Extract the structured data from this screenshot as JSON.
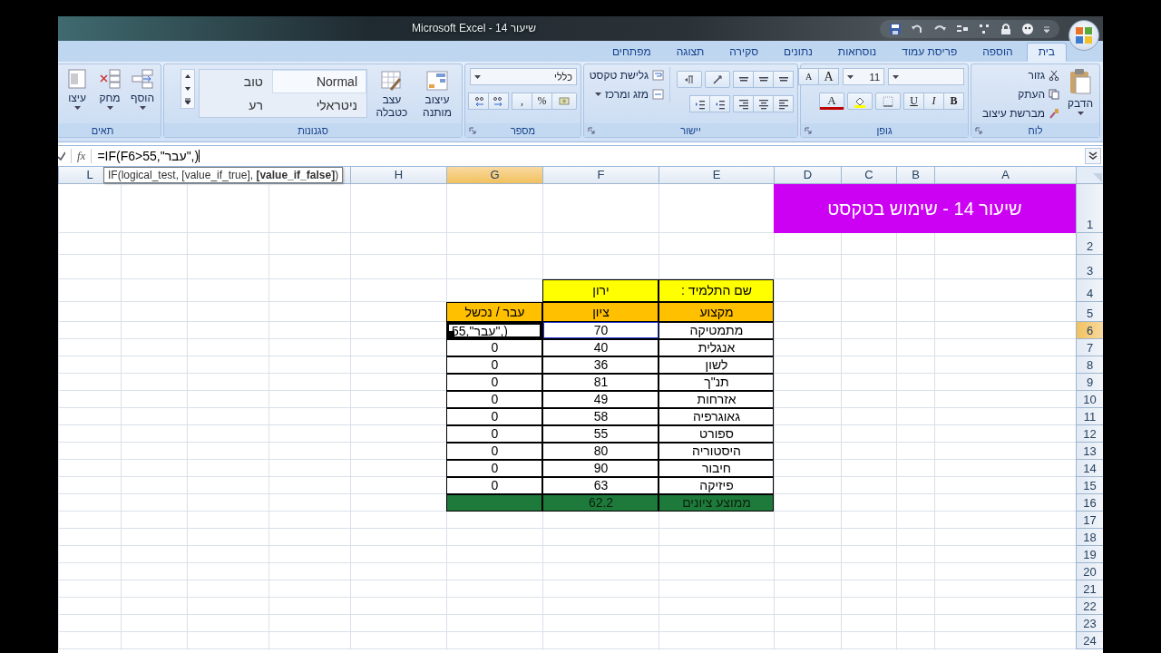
{
  "window": {
    "title": "Microsoft Excel - שיעור 14"
  },
  "tabs": [
    {
      "label": "בית",
      "selected": true
    },
    {
      "label": "הוספה",
      "selected": false
    },
    {
      "label": "פריסת עמוד",
      "selected": false
    },
    {
      "label": "נוסחאות",
      "selected": false
    },
    {
      "label": "נתונים",
      "selected": false
    },
    {
      "label": "סקירה",
      "selected": false
    },
    {
      "label": "תצוגה",
      "selected": false
    },
    {
      "label": "מפתחים",
      "selected": false
    }
  ],
  "ribbon": {
    "clipboard": {
      "label": "לוח",
      "paste": "הדבק",
      "cut": "גזור",
      "copy": "העתק",
      "format_painter": "מברשת עיצוב"
    },
    "font": {
      "label": "גופן",
      "size": "11",
      "grow": "A",
      "shrink": "A",
      "bold": "B",
      "italic": "I",
      "underline": "U",
      "font_color": "A"
    },
    "alignment": {
      "label": "יישור",
      "wrap_text": "גלישת טקסט",
      "merge_center": "מזג ומרכז"
    },
    "number": {
      "label": "מספר",
      "format": "כללי",
      "percent": "%",
      "comma": ","
    },
    "styles": {
      "label": "סגנונות",
      "conditional_formatting": "עיצוב מותנה",
      "format_as_table": "עצב כטבלה",
      "gallery": [
        {
          "label": "Normal",
          "selected": true
        },
        {
          "label": "טוב",
          "selected": false
        },
        {
          "label": "ניטראלי",
          "selected": false
        },
        {
          "label": "רע",
          "selected": false
        }
      ]
    },
    "cells": {
      "label": "תאים",
      "insert": "הוסף",
      "delete": "מחק",
      "format": "עיצו"
    }
  },
  "formula_bar": {
    "function_label": "fx",
    "formula": "=IF(F6>55,\"עבר\",)"
  },
  "tooltip": "IF(logical_test, [value_if_true], **[value_if_false]**)",
  "sheet": {
    "columns": [
      {
        "label": "A",
        "selected": false
      },
      {
        "label": "B",
        "selected": false
      },
      {
        "label": "C",
        "selected": false
      },
      {
        "label": "D",
        "selected": false
      },
      {
        "label": "E",
        "selected": false
      },
      {
        "label": "F",
        "selected": false
      },
      {
        "label": "G",
        "selected": true
      },
      {
        "label": "H",
        "selected": false
      },
      {},
      {},
      {},
      {
        "label": "L",
        "selected": false
      }
    ],
    "rows": [
      {
        "number": "1",
        "selected": false,
        "cells": {
          "A": {
            "text": "שיעור 14 - שימוש בטקסט",
            "kind": "title",
            "referenced": false
          }
        }
      },
      {
        "number": "2",
        "selected": false
      },
      {
        "number": "3",
        "selected": false
      },
      {
        "number": "4",
        "selected": false,
        "cells": {
          "E": {
            "text": "שם התלמיד :",
            "kind": "yellow",
            "referenced": false
          },
          "F": {
            "text": "ירון",
            "kind": "yellow",
            "referenced": false
          }
        }
      },
      {
        "number": "5",
        "selected": false,
        "cells": {
          "E": {
            "text": "מקצוע",
            "kind": "orange",
            "referenced": false
          },
          "F": {
            "text": "ציון",
            "kind": "orange",
            "referenced": false
          },
          "G": {
            "text": "עבר / נכשל",
            "kind": "orange",
            "referenced": false
          }
        }
      },
      {
        "number": "6",
        "selected": true,
        "cells": {
          "E": {
            "text": "מתמטיקה",
            "kind": "data",
            "referenced": false
          },
          "F": {
            "text": "70",
            "kind": "data",
            "referenced": true
          },
          "G": {
            "text": "55,\"עבר\",)",
            "kind": "editing",
            "referenced": false
          }
        }
      },
      {
        "number": "7",
        "selected": false,
        "cells": {
          "E": {
            "text": "אנגלית",
            "kind": "data",
            "referenced": false
          },
          "F": {
            "text": "40",
            "kind": "data",
            "referenced": false
          },
          "G": {
            "text": "0",
            "kind": "data",
            "referenced": false
          }
        }
      },
      {
        "number": "8",
        "selected": false,
        "cells": {
          "E": {
            "text": "לשון",
            "kind": "data",
            "referenced": false
          },
          "F": {
            "text": "36",
            "kind": "data",
            "referenced": false
          },
          "G": {
            "text": "0",
            "kind": "data",
            "referenced": false
          }
        }
      },
      {
        "number": "9",
        "selected": false,
        "cells": {
          "E": {
            "text": "תנ\"ך",
            "kind": "data",
            "referenced": false
          },
          "F": {
            "text": "81",
            "kind": "data",
            "referenced": false
          },
          "G": {
            "text": "0",
            "kind": "data",
            "referenced": false
          }
        }
      },
      {
        "number": "10",
        "selected": false,
        "cells": {
          "E": {
            "text": "אזרחות",
            "kind": "data",
            "referenced": false
          },
          "F": {
            "text": "49",
            "kind": "data",
            "referenced": false
          },
          "G": {
            "text": "0",
            "kind": "data",
            "referenced": false
          }
        }
      },
      {
        "number": "11",
        "selected": false,
        "cells": {
          "E": {
            "text": "גאוגרפיה",
            "kind": "data",
            "referenced": false
          },
          "F": {
            "text": "58",
            "kind": "data",
            "referenced": false
          },
          "G": {
            "text": "0",
            "kind": "data",
            "referenced": false
          }
        }
      },
      {
        "number": "12",
        "selected": false,
        "cells": {
          "E": {
            "text": "ספורט",
            "kind": "data",
            "referenced": false
          },
          "F": {
            "text": "55",
            "kind": "data",
            "referenced": false
          },
          "G": {
            "text": "0",
            "kind": "data",
            "referenced": false
          }
        }
      },
      {
        "number": "13",
        "selected": false,
        "cells": {
          "E": {
            "text": "היסטוריה",
            "kind": "data",
            "referenced": false
          },
          "F": {
            "text": "80",
            "kind": "data",
            "referenced": false
          },
          "G": {
            "text": "0",
            "kind": "data",
            "referenced": false
          }
        }
      },
      {
        "number": "14",
        "selected": false,
        "cells": {
          "E": {
            "text": "חיבור",
            "kind": "data",
            "referenced": false
          },
          "F": {
            "text": "90",
            "kind": "data",
            "referenced": false
          },
          "G": {
            "text": "0",
            "kind": "data",
            "referenced": false
          }
        }
      },
      {
        "number": "15",
        "selected": false,
        "cells": {
          "E": {
            "text": "פיזיקה",
            "kind": "data",
            "referenced": false
          },
          "F": {
            "text": "63",
            "kind": "data",
            "referenced": false
          },
          "G": {
            "text": "0",
            "kind": "data",
            "referenced": false
          }
        }
      },
      {
        "number": "16",
        "selected": false,
        "cells": {
          "E": {
            "text": "ממוצע ציונים",
            "kind": "total",
            "referenced": false
          },
          "F": {
            "text": "62.2",
            "kind": "total",
            "referenced": false
          },
          "G": {
            "kind": "total",
            "referenced": false
          }
        }
      },
      {
        "number": "17",
        "selected": false
      },
      {
        "number": "18",
        "selected": false
      },
      {
        "number": "19",
        "selected": false
      },
      {
        "number": "20",
        "selected": false
      },
      {
        "number": "21",
        "selected": false
      },
      {
        "number": "22",
        "selected": false
      },
      {
        "number": "23",
        "selected": false
      },
      {
        "number": "24",
        "selected": false
      }
    ]
  }
}
